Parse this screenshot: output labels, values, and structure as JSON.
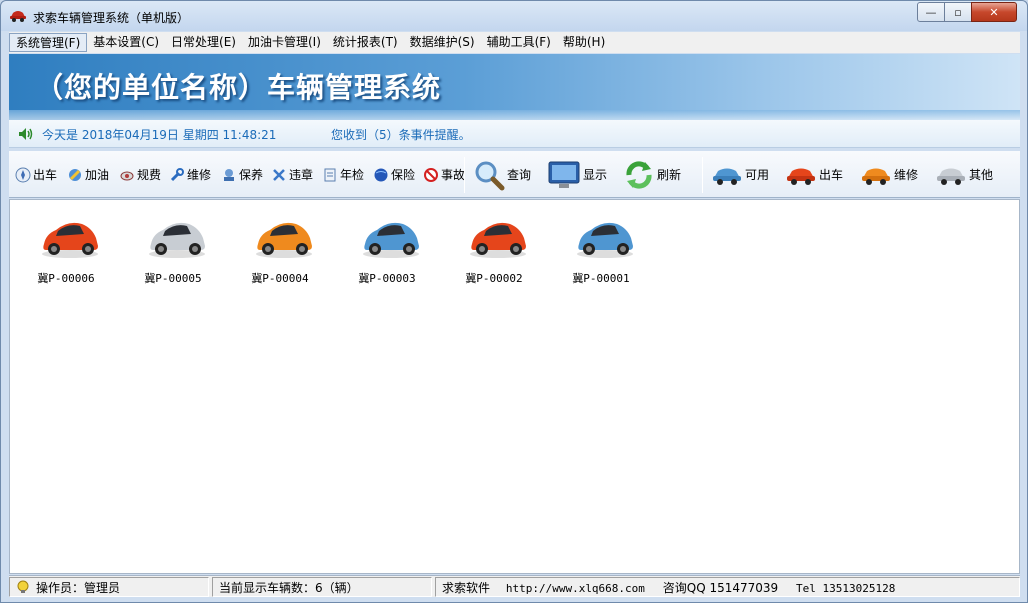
{
  "window": {
    "title": "求索车辆管理系统（单机版）",
    "minimize": "—",
    "maximize": "▫",
    "close": "✕"
  },
  "menu": [
    {
      "label": "系统管理(F)"
    },
    {
      "label": "基本设置(C)"
    },
    {
      "label": "日常处理(E)"
    },
    {
      "label": "加油卡管理(I)"
    },
    {
      "label": "统计报表(T)"
    },
    {
      "label": "数据维护(S)"
    },
    {
      "label": "辅助工具(F)"
    },
    {
      "label": "帮助(H)"
    }
  ],
  "banner": {
    "title": "（您的单位名称）车辆管理系统"
  },
  "info": {
    "today": "今天是 2018年04月19日 星期四 11:48:21",
    "events": "您收到（5）条事件提醒。"
  },
  "toolbar": {
    "outbound": "出车",
    "refuel": "加油",
    "fees": "规费",
    "repair": "维修",
    "maintain": "保养",
    "violation": "违章",
    "inspection": "年检",
    "insurance": "保险",
    "accident": "事故",
    "query": "查询",
    "display": "显示",
    "refresh": "刷新",
    "available": "可用",
    "status_out": "出车",
    "status_repair": "维修",
    "status_other": "其他"
  },
  "colors": {
    "red": "#e5451b",
    "silver": "#c8cdd3",
    "orange": "#ef8a1e",
    "blue": "#4f96d1"
  },
  "vehicles": [
    {
      "plate": "冀P-00006",
      "color": "#e5451b"
    },
    {
      "plate": "冀P-00005",
      "color": "#c8cdd3"
    },
    {
      "plate": "冀P-00004",
      "color": "#ef8a1e"
    },
    {
      "plate": "冀P-00003",
      "color": "#4f96d1"
    },
    {
      "plate": "冀P-00002",
      "color": "#e5451b"
    },
    {
      "plate": "冀P-00001",
      "color": "#4f96d1"
    }
  ],
  "status": {
    "operator": "操作员：管理员",
    "count": "当前显示车辆数：6（辆）",
    "company": "求索软件",
    "url": "http://www.xlq668.com",
    "qq": "咨询QQ 151477039",
    "tel": "Tel 13513025128"
  }
}
